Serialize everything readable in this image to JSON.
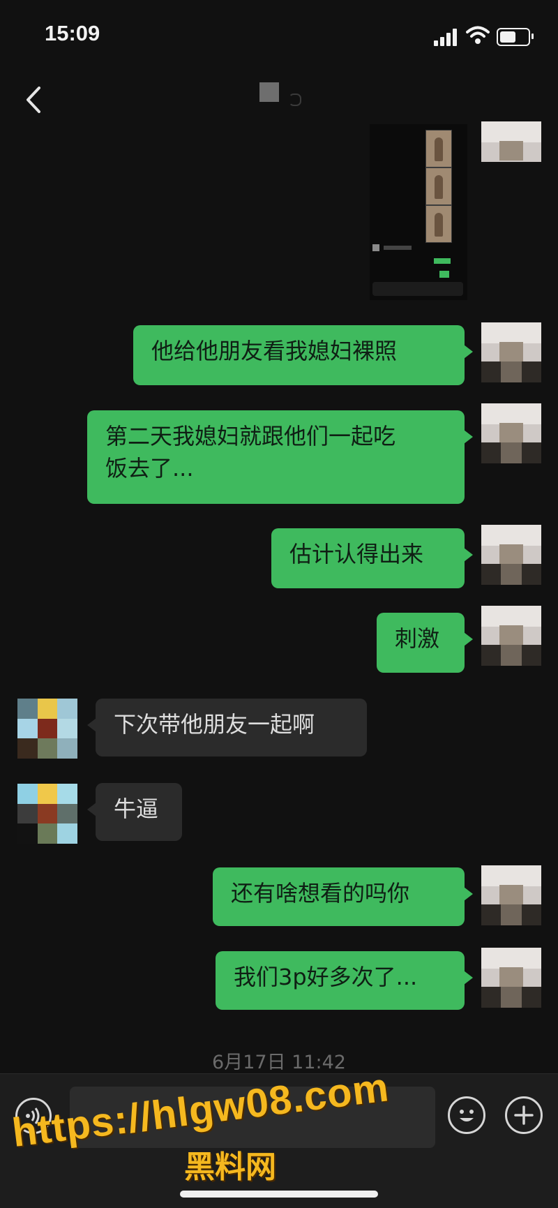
{
  "status_bar": {
    "time": "15:09"
  },
  "nav": {
    "back_icon": "chevron-left-icon"
  },
  "messages": [
    {
      "side": "out",
      "text": "他给他朋友看我媳妇裸照"
    },
    {
      "side": "out",
      "text": "第二天我媳妇就跟他们一起吃\n饭去了..."
    },
    {
      "side": "out",
      "text": "估计认得出来"
    },
    {
      "side": "out",
      "text": "刺激"
    },
    {
      "side": "in",
      "text": "下次带他朋友一起啊"
    },
    {
      "side": "in",
      "text": "牛逼"
    },
    {
      "side": "out",
      "text": "还有啥想看的吗你"
    },
    {
      "side": "out",
      "text": "我们3p好多次了..."
    }
  ],
  "timestamp": "6月17日 11:42",
  "input_bar": {
    "voice_icon": "voice-icon",
    "emoji_icon": "emoji-icon",
    "plus_icon": "plus-icon"
  },
  "watermark": {
    "url": "https://hlgw08.com",
    "name": "黑料网"
  },
  "colors": {
    "background": "#111111",
    "outgoing_bubble": "#3fba5e",
    "incoming_bubble": "#2b2b2b",
    "watermark": "#f5b81f"
  }
}
